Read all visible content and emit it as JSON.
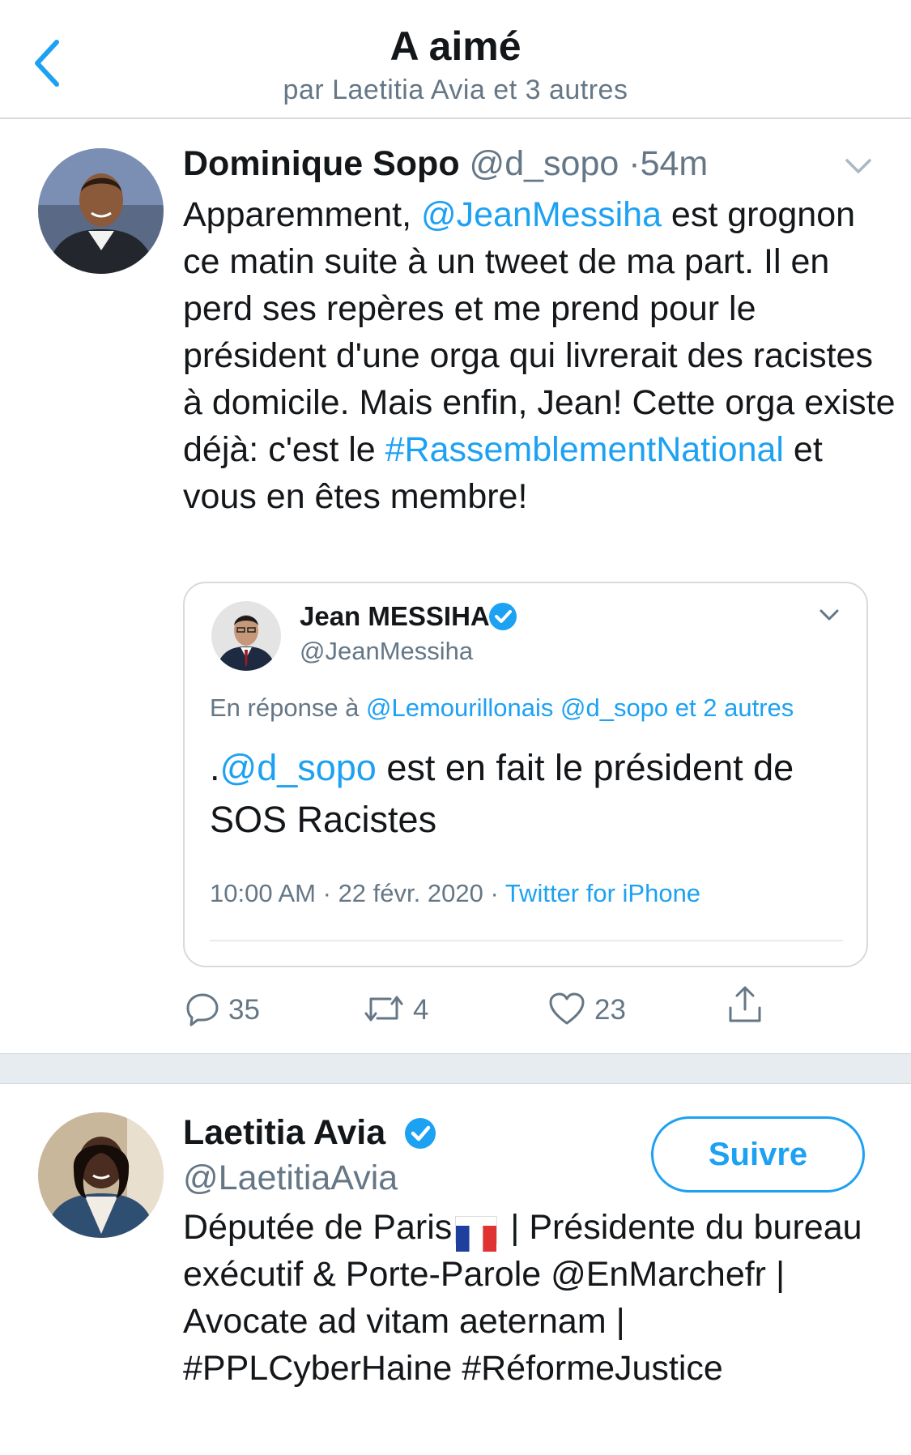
{
  "header": {
    "title": "A aimé",
    "subtitle": "par Laetitia Avia et 3 autres",
    "back_icon": "chevron-left-icon"
  },
  "tweet": {
    "author_name": "Dominique Sopo",
    "author_handle": "@d_sopo",
    "separator": "·",
    "time": "54m",
    "text_1": "Apparemment, ",
    "mention_1": "@JeanMessiha",
    "text_2": " est grognon ce matin suite à un tweet de ma part. Il en perd ses repères et me prend pour le président d'une orga qui livrerait des racistes à domicile. Mais enfin, Jean! Cette orga existe déjà: c'est le ",
    "hashtag_1": "#RassemblementNational",
    "text_3": " et vous en êtes membre!",
    "quoted": {
      "author_name": "Jean MESSIHA",
      "author_handle": "@JeanMessiha",
      "reply_prefix": "En réponse à ",
      "reply_mentions": "@Lemourillonais @d_sopo",
      "reply_suffix": " et 2 autres",
      "text_prefix": ".",
      "text_mention": "@d_sopo",
      "text_rest": " est en fait le président de SOS Racistes",
      "time": "10:00 AM",
      "date": "22 févr. 2020",
      "source": "Twitter for iPhone"
    },
    "actions": {
      "reply_count": "35",
      "retweet_count": "4",
      "like_count": "23"
    }
  },
  "user": {
    "name": "Laetitia Avia",
    "handle": "@LaetitiaAvia",
    "follow_label": "Suivre",
    "bio_1": "Députée de Paris",
    "bio_2": " | Présidente du bureau exécutif & Porte-Parole @EnMarchefr | Avocate ad vitam aeternam | #PPLCyberHaine #RéformeJustice"
  },
  "colors": {
    "accent": "#1da1f2",
    "muted": "#657786",
    "text": "#14171a",
    "border": "#d6dadd"
  }
}
